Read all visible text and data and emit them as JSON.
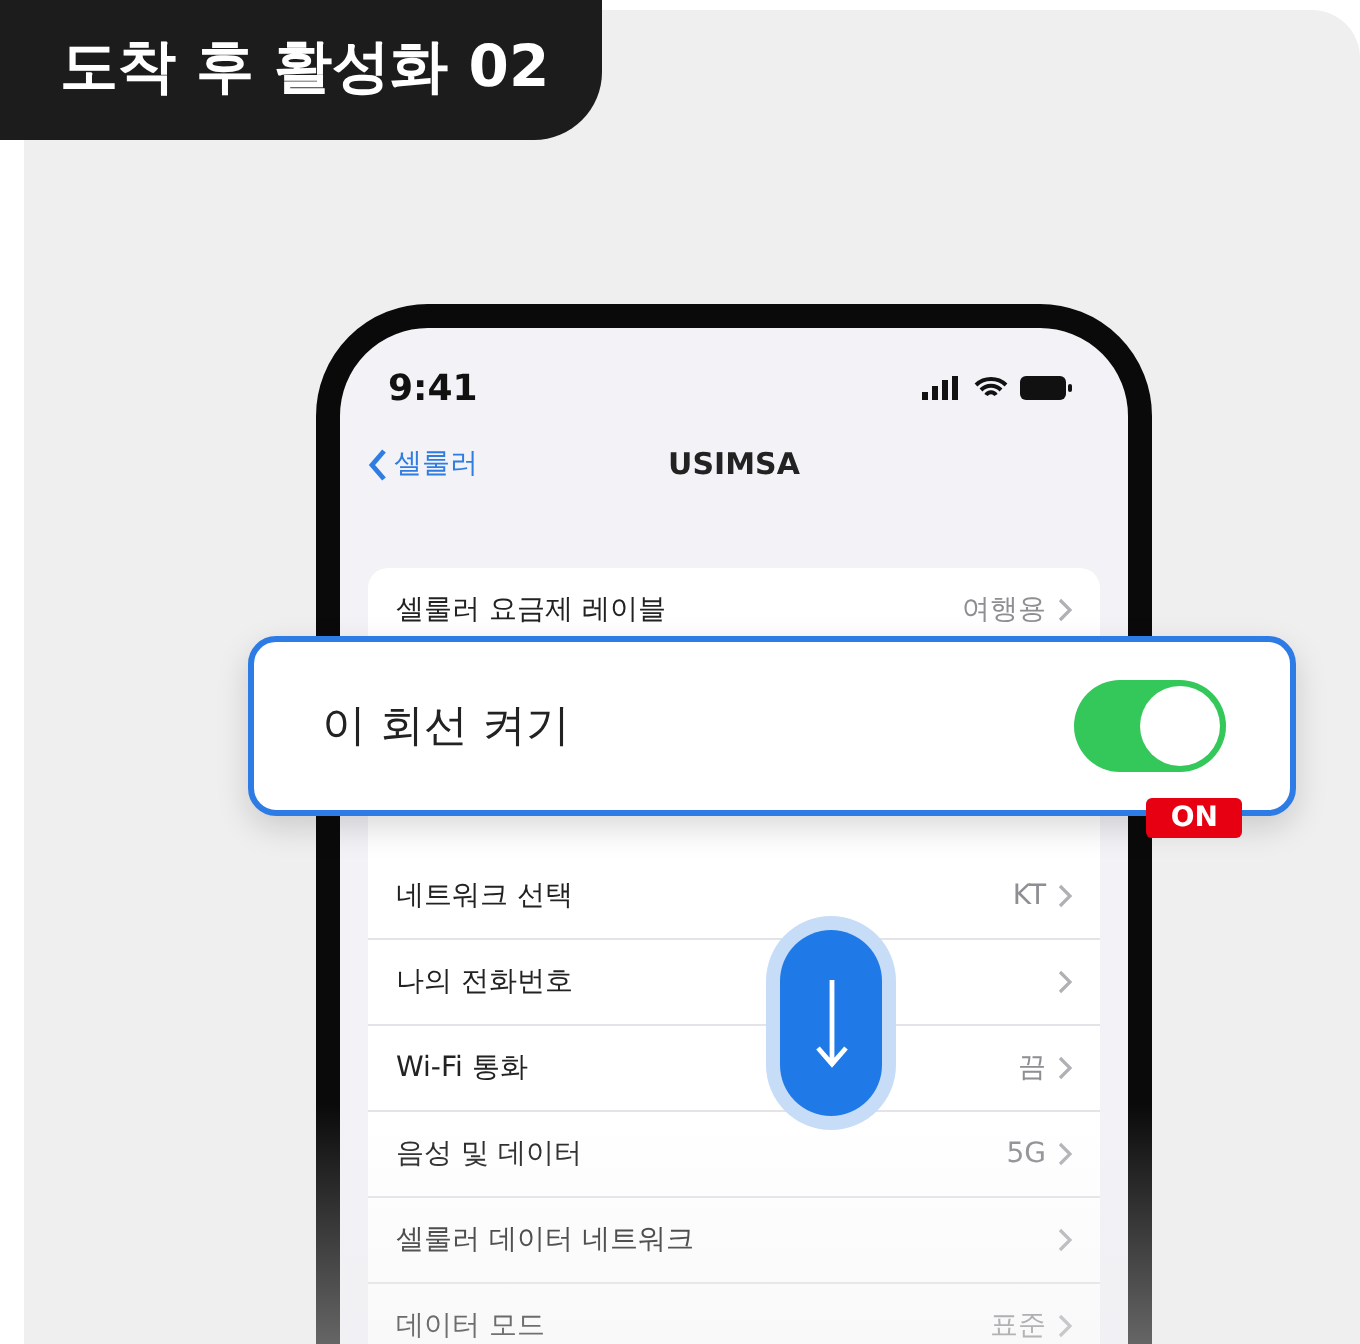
{
  "badge": "도착 후 활성화 02",
  "phone": {
    "status_bar": {
      "time": "9:41"
    },
    "nav": {
      "back": "셀룰러",
      "title": "USIMSA"
    },
    "rows": [
      {
        "label": "셀룰러 요금제 레이블",
        "value": "여행용"
      },
      {
        "label": "네트워크 선택",
        "value": "KT"
      },
      {
        "label": "나의 전화번호"
      },
      {
        "label": "Wi-Fi 통화",
        "value": "끔"
      },
      {
        "label": "음성 및 데이터",
        "value": "5G"
      },
      {
        "label": "셀룰러 데이터 네트워크"
      },
      {
        "label": "데이터 모드",
        "value": "표준"
      }
    ]
  },
  "popup": {
    "label": "이 회선 켜기",
    "on": true,
    "state_label": "ON"
  }
}
